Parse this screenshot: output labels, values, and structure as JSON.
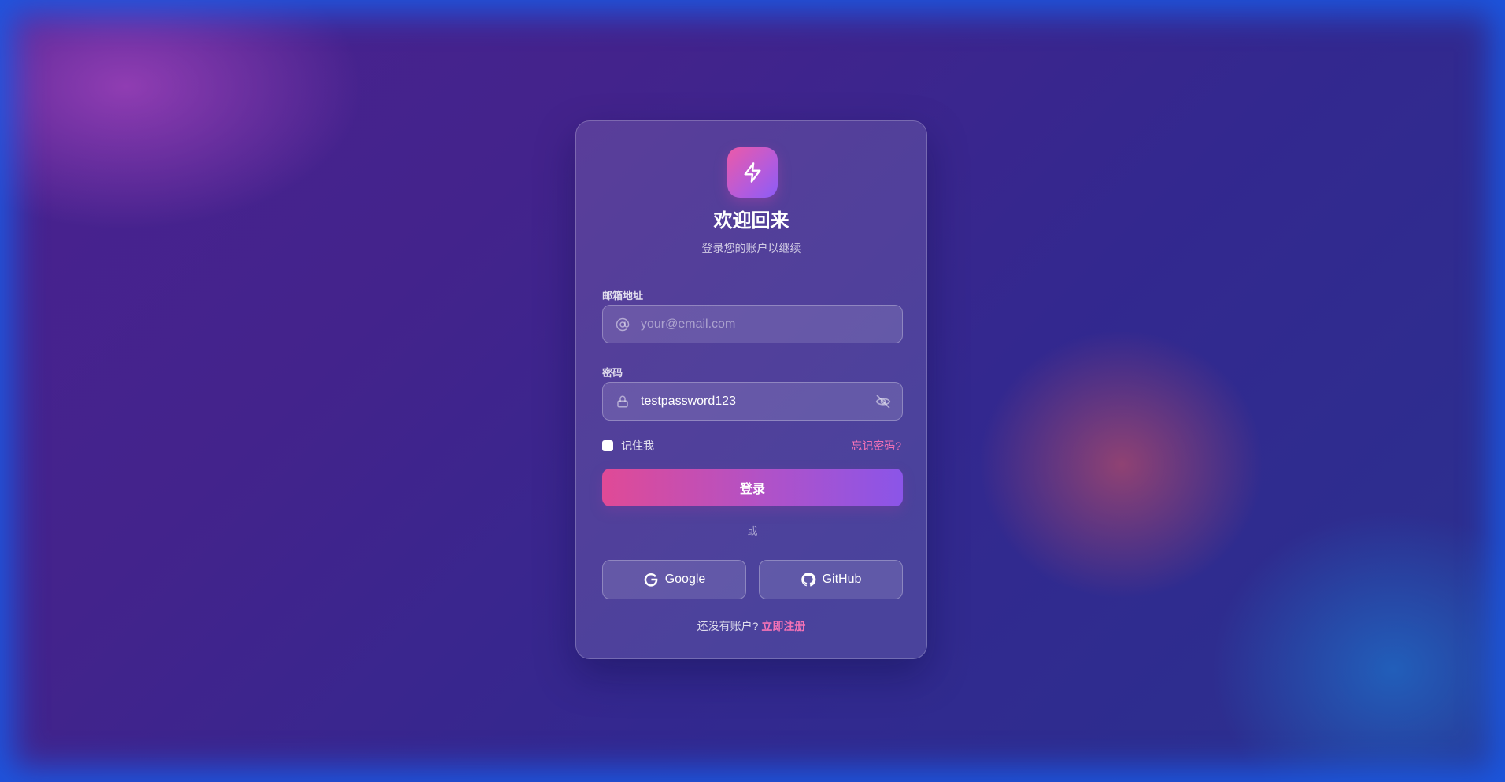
{
  "header": {
    "logo_icon": "lightning-bolt-icon",
    "title": "欢迎回来",
    "subtitle": "登录您的账户以继续"
  },
  "form": {
    "email": {
      "label": "邮箱地址",
      "icon": "at-sign-icon",
      "value": "",
      "placeholder": "your@email.com"
    },
    "password": {
      "label": "密码",
      "icon": "lock-icon",
      "value": "testpassword123",
      "toggle_icon": "eye-off-icon"
    },
    "remember": {
      "label": "记住我",
      "checked": false
    },
    "forgot_label": "忘记密码?",
    "submit_label": "登录"
  },
  "divider": {
    "label": "或"
  },
  "social": {
    "google_label": "Google",
    "google_icon": "google-icon",
    "github_label": "GitHub",
    "github_icon": "github-icon"
  },
  "signup": {
    "prompt": "还没有账户?",
    "link_label": "立即注册"
  },
  "colors": {
    "accent_pink": "#f472b6",
    "button_gradient_start": "#e04a96",
    "button_gradient_end": "#8b55e8"
  }
}
